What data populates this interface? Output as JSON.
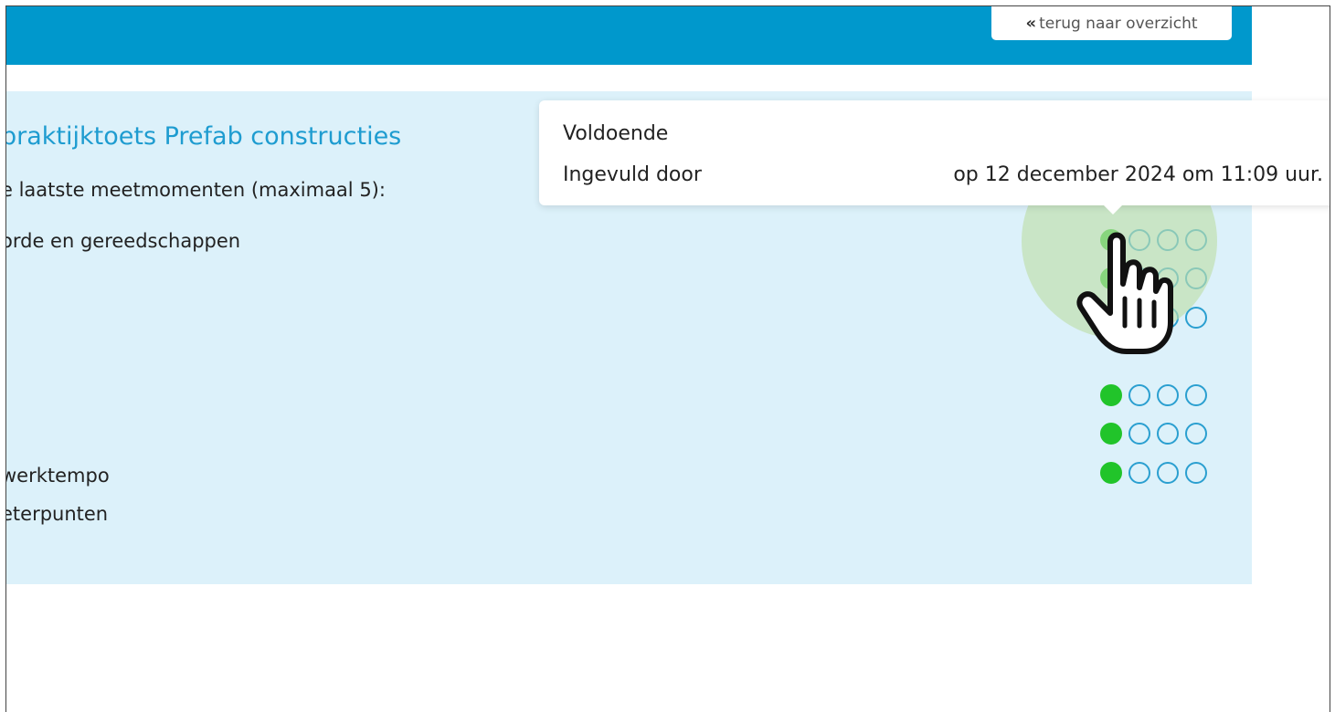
{
  "header": {
    "back_label": "terug naar overzicht",
    "back_icon": "double-chevron-left-icon",
    "color": "#0098cc"
  },
  "panel": {
    "title": "praktijktoets Prefab constructies",
    "subtitle": "e laatste meetmomenten (maximaal 5):",
    "background": "#dcf1fa"
  },
  "rows": [
    {
      "label": "orde en gereedschappen",
      "ratings": [
        true,
        false,
        false,
        false
      ]
    },
    {
      "label": "",
      "ratings": [
        true,
        false,
        false,
        false
      ]
    },
    {
      "label": "",
      "ratings": [
        true,
        false,
        false,
        false
      ]
    },
    {
      "label": "",
      "ratings": [
        true,
        false,
        false,
        false
      ]
    },
    {
      "label": "",
      "ratings": [
        true,
        false,
        false,
        false
      ]
    },
    {
      "label": "werktempo",
      "ratings": [
        true,
        false,
        false,
        false
      ]
    },
    {
      "label": "eterpunten",
      "ratings": []
    }
  ],
  "tooltip": {
    "status": "Voldoende",
    "filled_by_label": "Ingevuld door",
    "date_text": "op 12 december 2024 om 11:09 uur."
  },
  "colors": {
    "filled_dot": "#21c42a",
    "empty_dot_border": "#2a9fd0",
    "title": "#1e9cd0"
  },
  "cursor_icon": "hand-pointer-icon"
}
